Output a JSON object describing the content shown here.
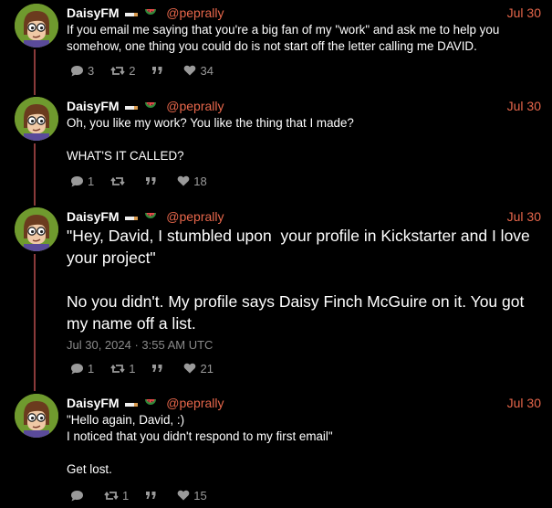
{
  "colors": {
    "accent": "#e8674b",
    "thread": "#8a3a3a",
    "muted": "#9a9a9a"
  },
  "icons": [
    "reply-icon",
    "repost-icon",
    "quote-icon",
    "heart-icon",
    "cigarette-emoji",
    "watermelon-emoji"
  ],
  "posts": [
    {
      "name": "DaisyFM",
      "handle": "@peprally",
      "date": "Jul 30",
      "text": "If you email me saying that you're a big fan of my \"work\" and ask me to help you somehow, one thing you could do is not start off the letter calling me DAVID.",
      "replies": "3",
      "reposts": "2",
      "quotes": "",
      "likes": "34"
    },
    {
      "name": "DaisyFM",
      "handle": "@peprally",
      "date": "Jul 30",
      "text": "Oh, you like my work? You like the thing that I made?\n\nWHAT'S IT CALLED?",
      "replies": "1",
      "reposts": "",
      "quotes": "",
      "likes": "18"
    },
    {
      "name": "DaisyFM",
      "handle": "@peprally",
      "date": "Jul 30",
      "text": "\"Hey, David, I stumbled upon  your profile in Kickstarter and I love your project\"\n\nNo you didn't. My profile says Daisy Finch McGuire on it. You got my name off a list.",
      "timestamp": "Jul 30, 2024 · 3:55 AM UTC",
      "replies": "1",
      "reposts": "1",
      "quotes": "",
      "likes": "21"
    },
    {
      "name": "DaisyFM",
      "handle": "@peprally",
      "date": "Jul 30",
      "text": "\"Hello again, David, :)\nI noticed that you didn't respond to my first email\"\n\nGet lost.",
      "replies": "",
      "reposts": "1",
      "quotes": "",
      "likes": "15"
    }
  ]
}
